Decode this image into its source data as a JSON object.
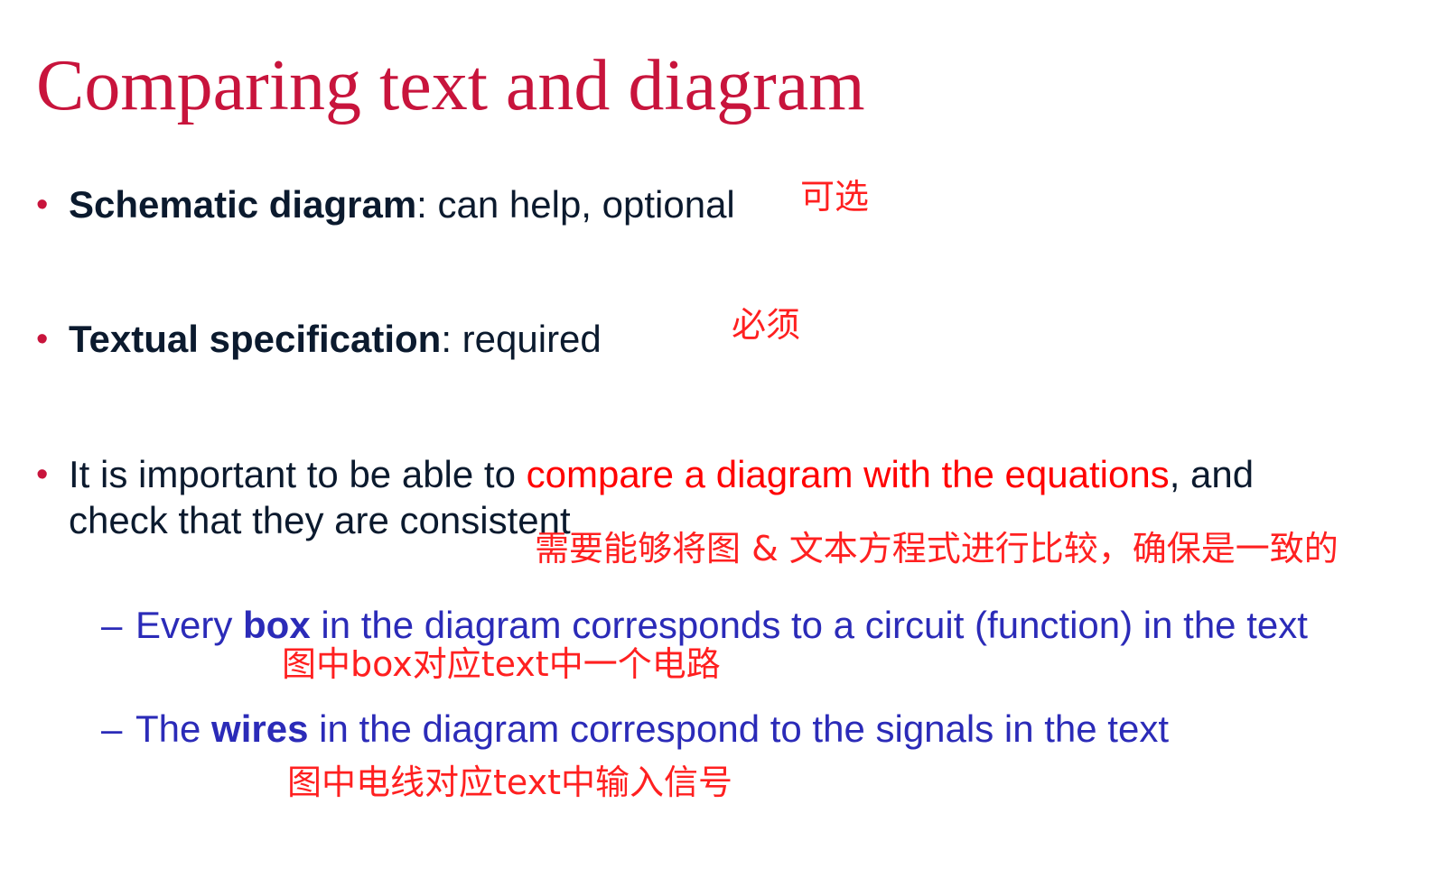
{
  "title": "Comparing text and diagram",
  "bullets": [
    {
      "marker": "•",
      "bold": "Schematic diagram",
      "rest": ": can help, optional",
      "note": "可选"
    },
    {
      "marker": "•",
      "bold": "Textual specification",
      "rest": ": required",
      "note": "必须"
    },
    {
      "marker": "•",
      "line1_pre": "It is important to be able to ",
      "line1_highlight": "compare a diagram with the equations",
      "line1_post": ", and",
      "line2": "check that they are consistent",
      "note": "需要能够将图 & 文本方程式进行比较，确保是一致的"
    }
  ],
  "sub_bullets": [
    {
      "marker": "–",
      "pre": "Every ",
      "bold": "box",
      "post": " in the diagram corresponds to a circuit (function) in the text",
      "note": "图中box对应text中一个电路"
    },
    {
      "marker": "–",
      "pre": "The ",
      "bold": "wires",
      "post": " in the diagram correspond to the signals in the text",
      "note": "图中电线对应text中输入信号"
    }
  ],
  "colors": {
    "title": "#c8143c",
    "body_text": "#0b1a2e",
    "highlight": "#ff0000",
    "sub_text": "#2b2bb8",
    "annotation": "#ff2020"
  }
}
